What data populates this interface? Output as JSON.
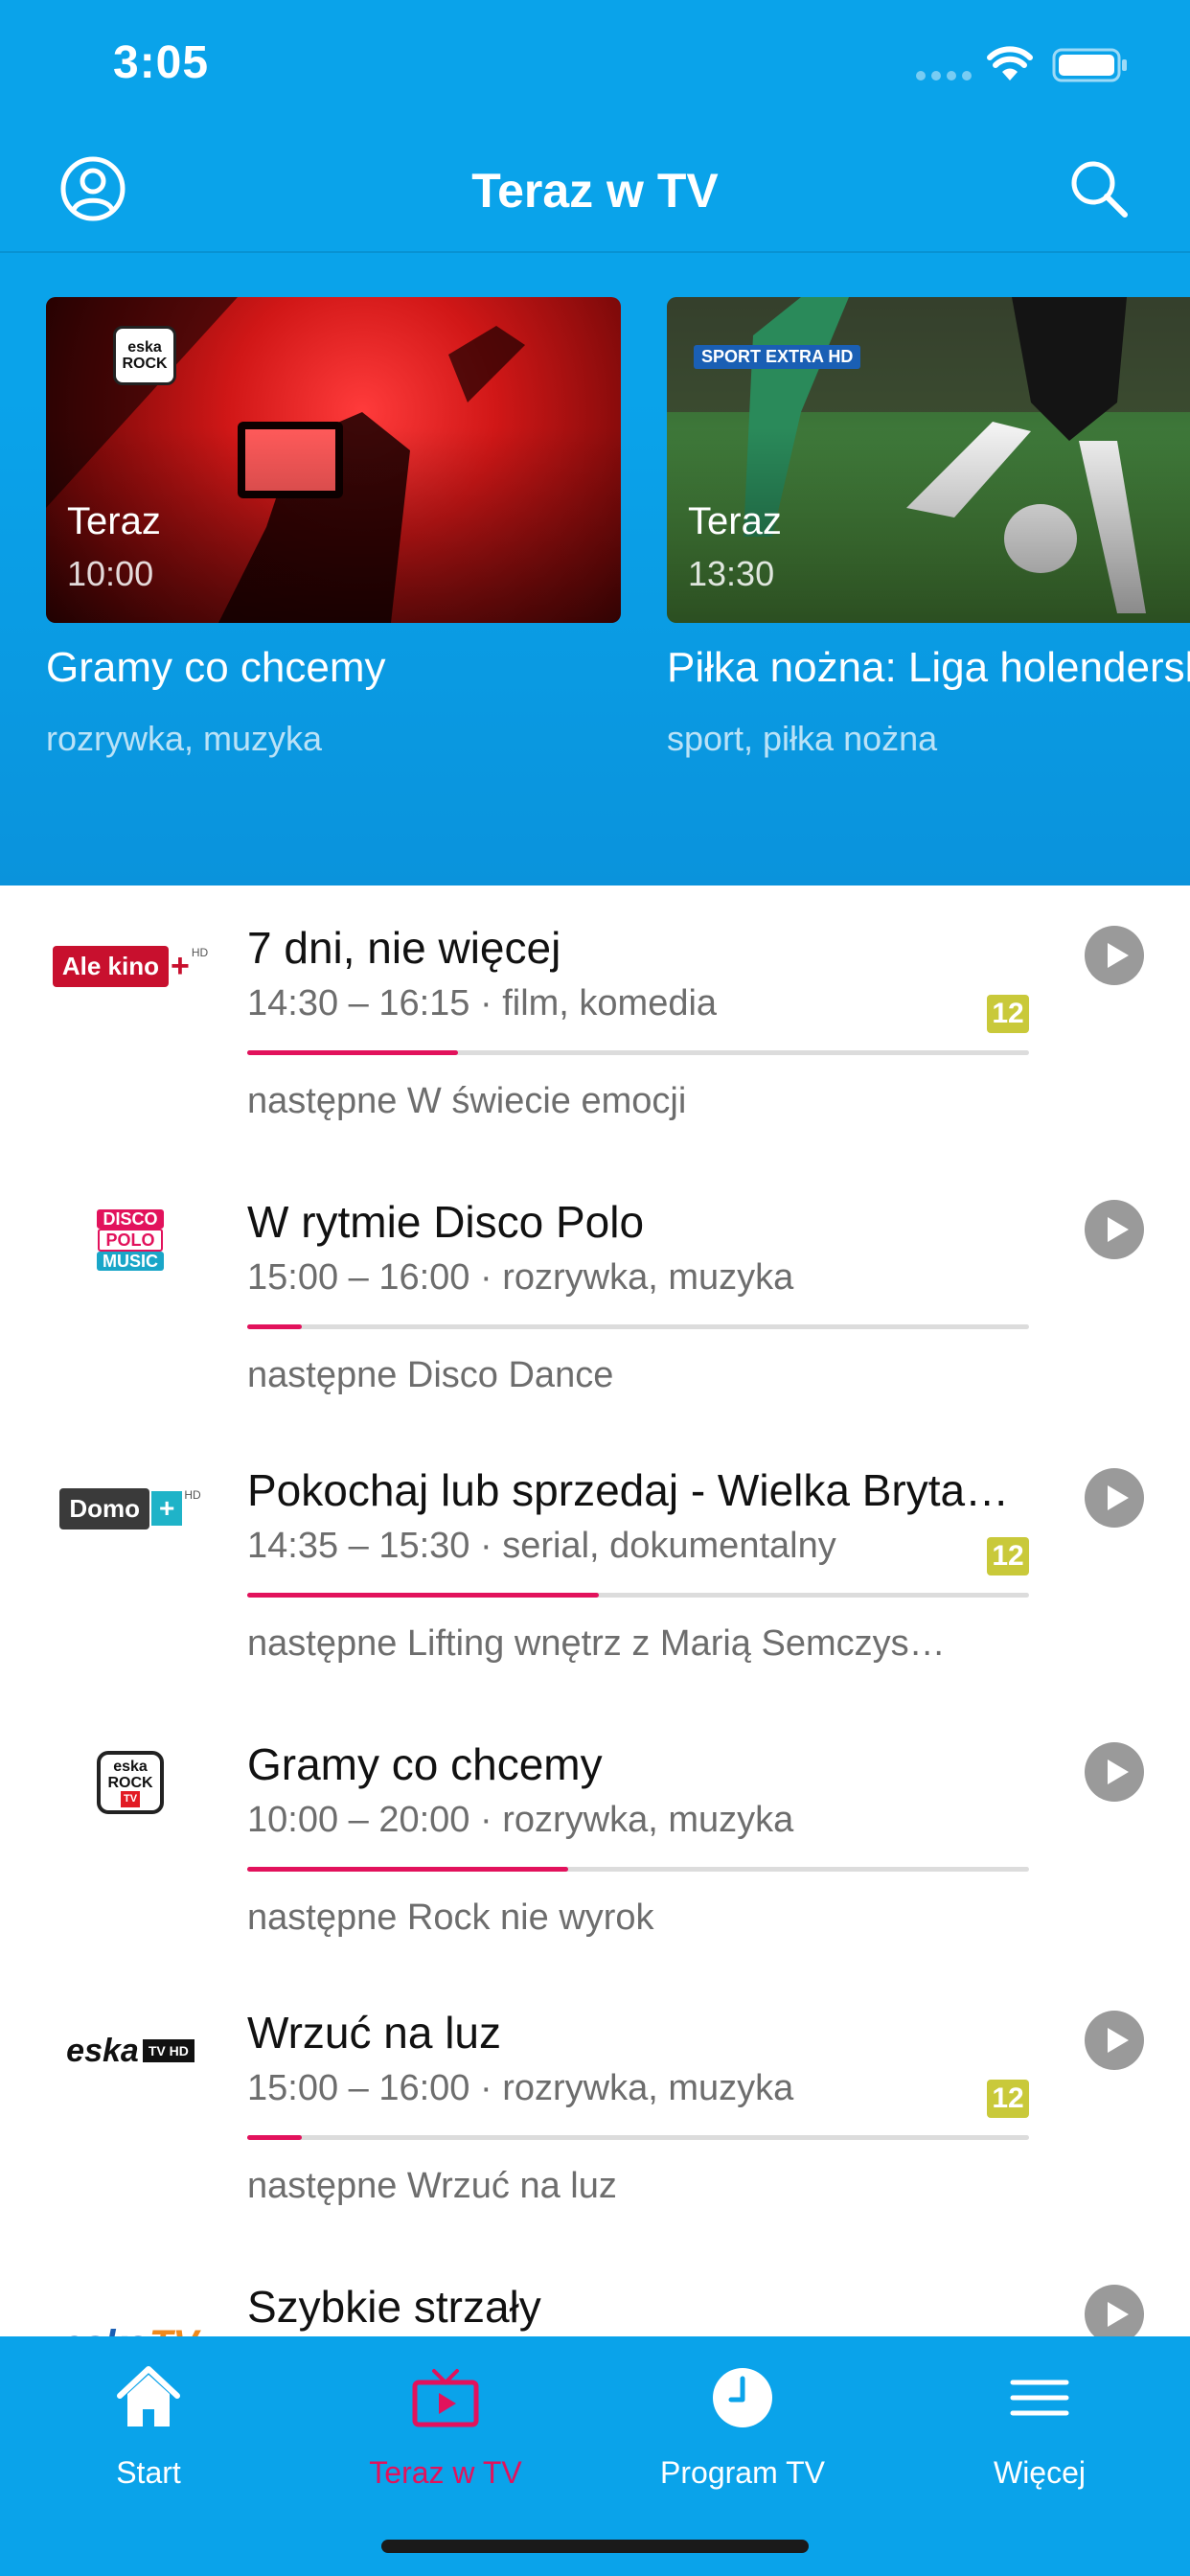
{
  "status_bar": {
    "time": "3:05"
  },
  "header": {
    "title": "Teraz w TV"
  },
  "carousel": [
    {
      "now_label": "Teraz",
      "time": "10:00",
      "title": "Gramy co chcemy",
      "genre": "rozrywka, muzyka",
      "channel_logo": "ESKA ROCK TV"
    },
    {
      "now_label": "Teraz",
      "time": "13:30",
      "title": "Piłka nożna: Liga holenderska",
      "genre": "sport, piłka nożna",
      "channel_logo": "POLSAT SPORT EXTRA HD"
    }
  ],
  "programs": [
    {
      "channel": "Ale kino+ HD",
      "title": "7 dni, nie więcej",
      "meta": "14:30 – 16:15 · film, komedia",
      "progress": 0.27,
      "next": "następne W świecie emocji",
      "age": "12"
    },
    {
      "channel": "Disco Polo Music",
      "title": "W rytmie Disco Polo",
      "meta": "15:00 – 16:00 · rozrywka, muzyka",
      "progress": 0.07,
      "next": "następne Disco Dance",
      "age": ""
    },
    {
      "channel": "Domo+ HD",
      "title": "Pokochaj lub sprzedaj - Wielka Brytani…",
      "meta": "14:35 – 15:30 · serial, dokumentalny",
      "progress": 0.45,
      "next": "następne Lifting wnętrz z Marią Semczys…",
      "age": "12"
    },
    {
      "channel": "ESKA ROCK TV",
      "title": "Gramy co chcemy",
      "meta": "10:00 – 20:00 · rozrywka, muzyka",
      "progress": 0.41,
      "next": "następne Rock nie wyrok",
      "age": ""
    },
    {
      "channel": "ESKA TV Extra HD",
      "title": "Wrzuć na luz",
      "meta": "15:00 – 16:00 · rozrywka, muzyka",
      "progress": 0.07,
      "next": "następne Wrzuć na luz",
      "age": "12"
    },
    {
      "channel": "ESKA TV",
      "title": "Szybkie strzały",
      "meta": "",
      "progress": 0,
      "next": "",
      "age": ""
    }
  ],
  "tabs": [
    {
      "label": "Start",
      "icon": "home-icon",
      "active": false
    },
    {
      "label": "Teraz w TV",
      "icon": "tv-icon",
      "active": true
    },
    {
      "label": "Program TV",
      "icon": "clock-icon",
      "active": false
    },
    {
      "label": "Więcej",
      "icon": "menu-icon",
      "active": false
    }
  ],
  "colors": {
    "primary": "#0aa3ea",
    "accent": "#e2125c",
    "age_badge": "#c9c93a"
  }
}
